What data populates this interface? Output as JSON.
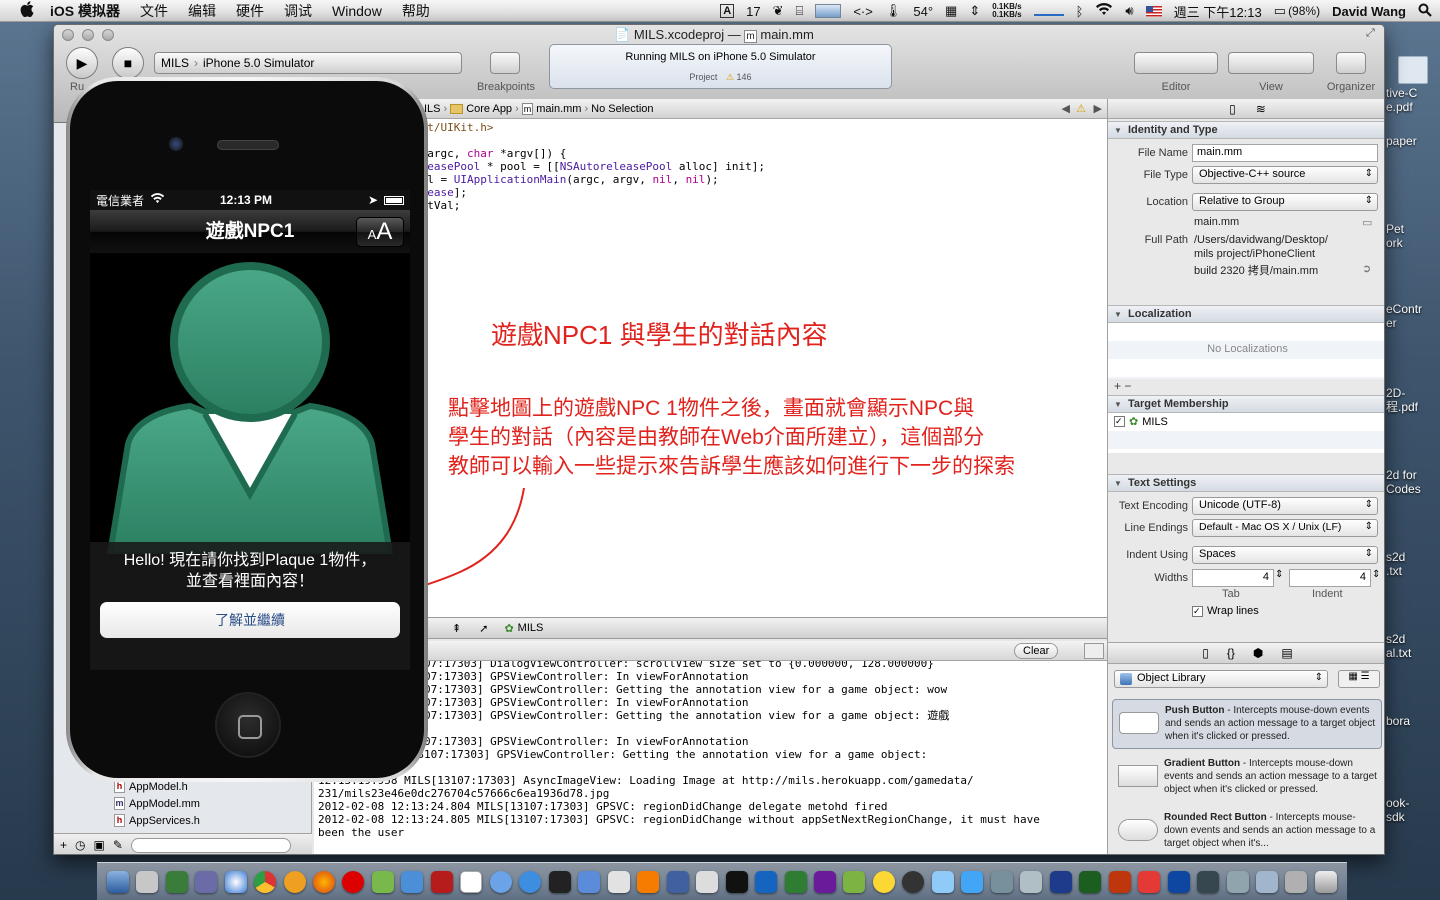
{
  "menubar": {
    "apple": "",
    "app": "iOS 模拟器",
    "items": [
      "文件",
      "编辑",
      "硬件",
      "调试",
      "Window",
      "帮助"
    ],
    "status": {
      "input_method": "A",
      "badge_count": "17",
      "arrows": "<·>",
      "temperature": "54°",
      "net_up": "0.1KB/s",
      "net_down": "0.1KB/s",
      "datetime": "週三 下午12:13",
      "battery": "(98%)",
      "user": "David Wang"
    }
  },
  "desktop": {
    "files": [
      "tive-C\ne.pdf",
      "paper",
      "Pet\nork",
      "eContr\ner",
      "2D-\n程.pdf",
      "2d for\nCodes",
      "s2d\n.txt",
      "s2d\nal.txt",
      "bora",
      "ook-\nsdk"
    ]
  },
  "xcode": {
    "window_title_project": "MILS.xcodeproj",
    "window_title_sep": "—",
    "window_title_file": "main.mm",
    "toolbar": {
      "run_label": "Ru",
      "scheme_name": "MILS",
      "scheme_dest": "iPhone 5.0 Simulator",
      "breakpoints_label": "Breakpoints",
      "activity_title": "Running MILS on iPhone 5.0 Simulator",
      "activity_project": "Project",
      "activity_warnings": "146",
      "editor_label": "Editor",
      "view_label": "View",
      "organizer_label": "Organizer"
    },
    "jumpbar": [
      "ILS",
      "Core App",
      "main.mm",
      "No Selection"
    ],
    "code": [
      "Kit/UIKit.h>",
      "",
      "t argc, char *argv[]) {",
      "eleasePool * pool = [[NSAutoreleasePool alloc] init];",
      "Val = UIApplicationMain(argc, argv, nil, nil);",
      "elease];",
      "retVal;"
    ],
    "debug_target": "MILS",
    "console_clear": "Clear",
    "console": [
      ":19.945 MILS[13107:17303] DialogViewController: scrollView size set to {0.000000, 128.000000}",
      ":19.956 MILS[13107:17303] GPSViewController: In viewForAnnotation",
      ":19.956 MILS[13107:17303] GPSViewController: Getting the annotation view for a game object: wow",
      ":19.957 MILS[13107:17303] GPSViewController: In viewForAnnotation",
      ":19.957 MILS[13107:17303] GPSViewController: Getting the annotation view for a game object: 遊戲",
      "",
      ":19.957 MILS[13107:17303] GPSViewController: In viewForAnnotation",
      "3:19.958 MILS[13107:17303] GPSViewController: Getting the annotation view for a game object:",
      "",
      "12:13:19.958 MILS[13107:17303] AsyncImageView: Loading Image at http://mils.herokuapp.com/gamedata/",
      "231/mils23e46e0dc276704c57666c6ea1936d78.jpg",
      "2012-02-08 12:13:24.804 MILS[13107:17303] GPSVC: regionDidChange delegate metohd fired",
      "2012-02-08 12:13:24.805 MILS[13107:17303] GPSVC: regionDidChange without appSetNextRegionChange, it must have",
      "been the user"
    ],
    "navigator_files": [
      {
        "icon": "h",
        "name": "AppModel.h"
      },
      {
        "icon": "m",
        "name": "AppModel.mm"
      },
      {
        "icon": "h",
        "name": "AppServices.h"
      }
    ],
    "inspector": {
      "identity_header": "Identity and Type",
      "file_name_label": "File Name",
      "file_name": "main.mm",
      "file_type_label": "File Type",
      "file_type": "Objective-C++ source",
      "location_label": "Location",
      "location": "Relative to Group",
      "location_file": "main.mm",
      "full_path_label": "Full Path",
      "full_path_1": "/Users/davidwang/Desktop/",
      "full_path_2": "mils project/iPhoneClient",
      "full_path_3": "build 2320 拷貝/main.mm",
      "localization_header": "Localization",
      "no_localizations": "No Localizations",
      "target_header": "Target Membership",
      "target_name": "MILS",
      "text_settings_header": "Text Settings",
      "text_encoding_label": "Text Encoding",
      "text_encoding": "Unicode (UTF-8)",
      "line_endings_label": "Line Endings",
      "line_endings": "Default - Mac OS X / Unix (LF)",
      "indent_using_label": "Indent Using",
      "indent_using": "Spaces",
      "widths_label": "Widths",
      "tab_width": "4",
      "indent_width": "4",
      "tab_label": "Tab",
      "indent_label": "Indent",
      "wrap_lines": "Wrap lines",
      "library_popup": "Object Library",
      "library": [
        {
          "title": "Push Button",
          "desc": " - Intercepts mouse-down events and sends an action message to a target object when it's clicked or pressed."
        },
        {
          "title": "Gradient Button",
          "desc": " - Intercepts mouse-down events and sends an action message to a target object when it's clicked or pressed."
        },
        {
          "title": "Rounded Rect Button",
          "desc": " - Intercepts mouse-down events and sends an action message to a target object when it's..."
        }
      ]
    }
  },
  "simulator": {
    "carrier": "電信業者",
    "time": "12:13 PM",
    "nav_title": "遊戲NPC1",
    "font_button": "AA",
    "dialog_line1": "Hello! 現在請你找到Plaque 1物件，",
    "dialog_line2": "並查看裡面內容！",
    "continue_button": "了解並繼續"
  },
  "annotations": {
    "title": "遊戲NPC1 與學生的對話內容",
    "line1": "點擊地圖上的遊戲NPC 1物件之後，畫面就會顯示NPC與",
    "line2": "學生的對話（內容是由教師在Web介面所建立），這個部分",
    "line3": "教師可以輸入一些提示來告訴學生應該如何進行下一步的探索"
  },
  "colors": {
    "annotation": "#e0231d",
    "npc_green": "#2f8f6e",
    "nav_bar": "#1b1b1b"
  }
}
